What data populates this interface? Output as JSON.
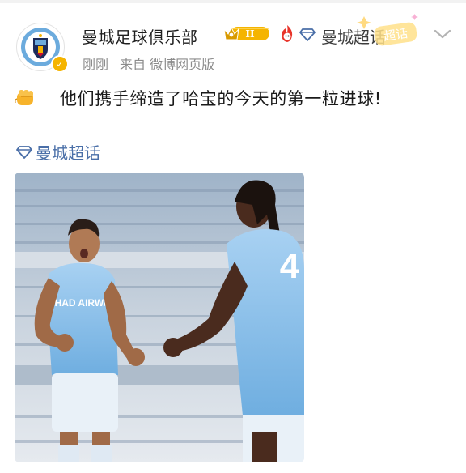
{
  "post": {
    "author": {
      "name": "曼城足球俱乐部",
      "avatar_icon": "man-city-crest-icon",
      "avatar_text": "MANCHESTER CITY",
      "verified_icon": "verified-badge-icon",
      "level_badge": "II",
      "level_badge_icon": "crown-level-badge-icon"
    },
    "fire_icon": "fire-mascot-icon",
    "topic_header": {
      "icon": "diamond-icon",
      "label": "曼城超话"
    },
    "sticker_text": "超话",
    "meta": {
      "time": "刚刚",
      "source": "来自 微博网页版"
    },
    "emoji": "fist-bump-icon",
    "text": "他们携手缔造了哈宝的今天的第一粒进球!",
    "topic_link": {
      "icon": "diamond-icon",
      "label": "曼城超话"
    },
    "photo": {
      "description_icon": "photo-icon",
      "jersey_text": "ETIHAD AIRWAYS",
      "jersey_number": "4"
    }
  },
  "colors": {
    "text_primary": "#1f1f1f",
    "text_meta": "#8c8c8c",
    "topic_link": "#4a6fa8",
    "badge_gold": "#f5b400",
    "city_blue": "#7fb5e6"
  }
}
